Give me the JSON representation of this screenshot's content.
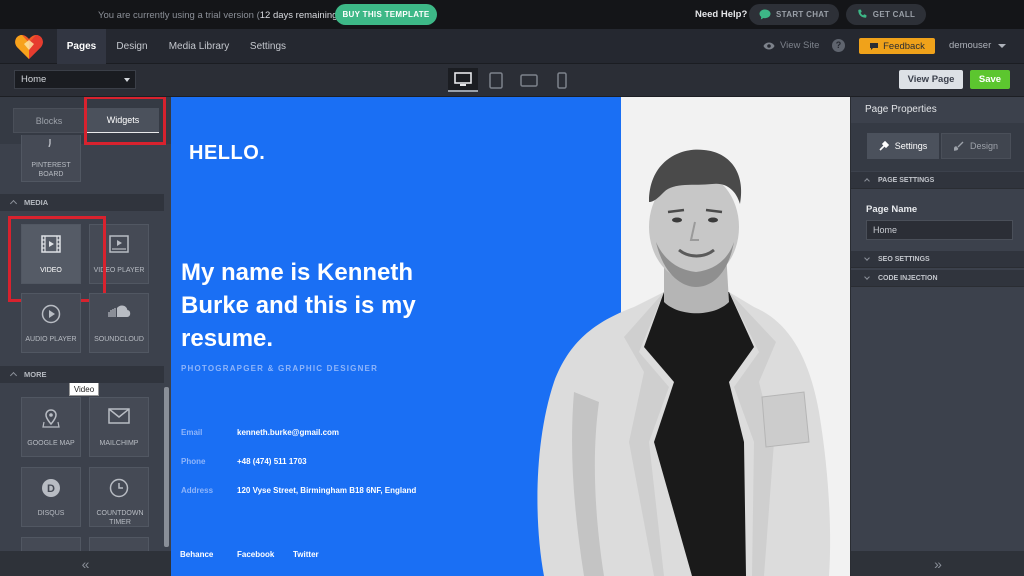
{
  "trial_bar": {
    "message_before": "You are currently using a trial version (",
    "message_bold": "12 days remaining",
    "message_after": ")",
    "buy_label": "BUY THIS TEMPLATE",
    "need_help": "Need Help?",
    "chat_label": "START CHAT",
    "call_label": "GET CALL",
    "buy_color": "#3db887"
  },
  "nav": {
    "tabs": [
      "Pages",
      "Design",
      "Media Library",
      "Settings"
    ],
    "active_tab": "Pages",
    "view_site": "View Site",
    "help": "?",
    "feedback": "Feedback",
    "user": "demouser",
    "feedback_color": "#f0a21a",
    "logo_icon": "heart-logo-icon"
  },
  "toolbar": {
    "page_select": "Home",
    "devices": [
      "desktop-icon",
      "tablet-icon",
      "tablet-landscape-icon",
      "mobile-icon"
    ],
    "active_device": "desktop",
    "view_page": "View Page",
    "save": "Save",
    "save_color": "#5cc62f"
  },
  "left_panel": {
    "tabs": [
      "Blocks",
      "Widgets"
    ],
    "active_tab": "Widgets",
    "partial_widget": "PINTEREST BOARD",
    "media_header": "MEDIA",
    "media_widgets": [
      "VIDEO",
      "VIDEO PLAYER",
      "AUDIO PLAYER",
      "SOUNDCLOUD"
    ],
    "tooltip": "Video",
    "more_header": "MORE",
    "more_widgets": [
      "GOOGLE MAP",
      "MAILCHIMP",
      "DISQUS",
      "COUNTDOWN TIMER"
    ],
    "collapse_glyph": "«"
  },
  "canvas": {
    "hello": "HELLO.",
    "heading": "My name is Kenneth Burke and this is my resume.",
    "subtitle": "PHOTOGRAPGER & GRAPHIC DESIGNER",
    "contacts": [
      {
        "label": "Email",
        "value": "kenneth.burke@gmail.com"
      },
      {
        "label": "Phone",
        "value": "+48 (474) 511 1703"
      },
      {
        "label": "Address",
        "value": "120 Vyse Street, Birmingham B18 6NF, England"
      }
    ],
    "social": [
      "Behance",
      "Facebook",
      "Twitter"
    ],
    "accent_color": "#1a6ff4"
  },
  "right_panel": {
    "title": "Page Properties",
    "tabs": [
      "Settings",
      "Design"
    ],
    "active_tab": "Settings",
    "sections": [
      "PAGE SETTINGS",
      "SEO SETTINGS",
      "CODE INJECTION"
    ],
    "page_name_label": "Page Name",
    "page_name_value": "Home",
    "expand_glyph": "»"
  }
}
